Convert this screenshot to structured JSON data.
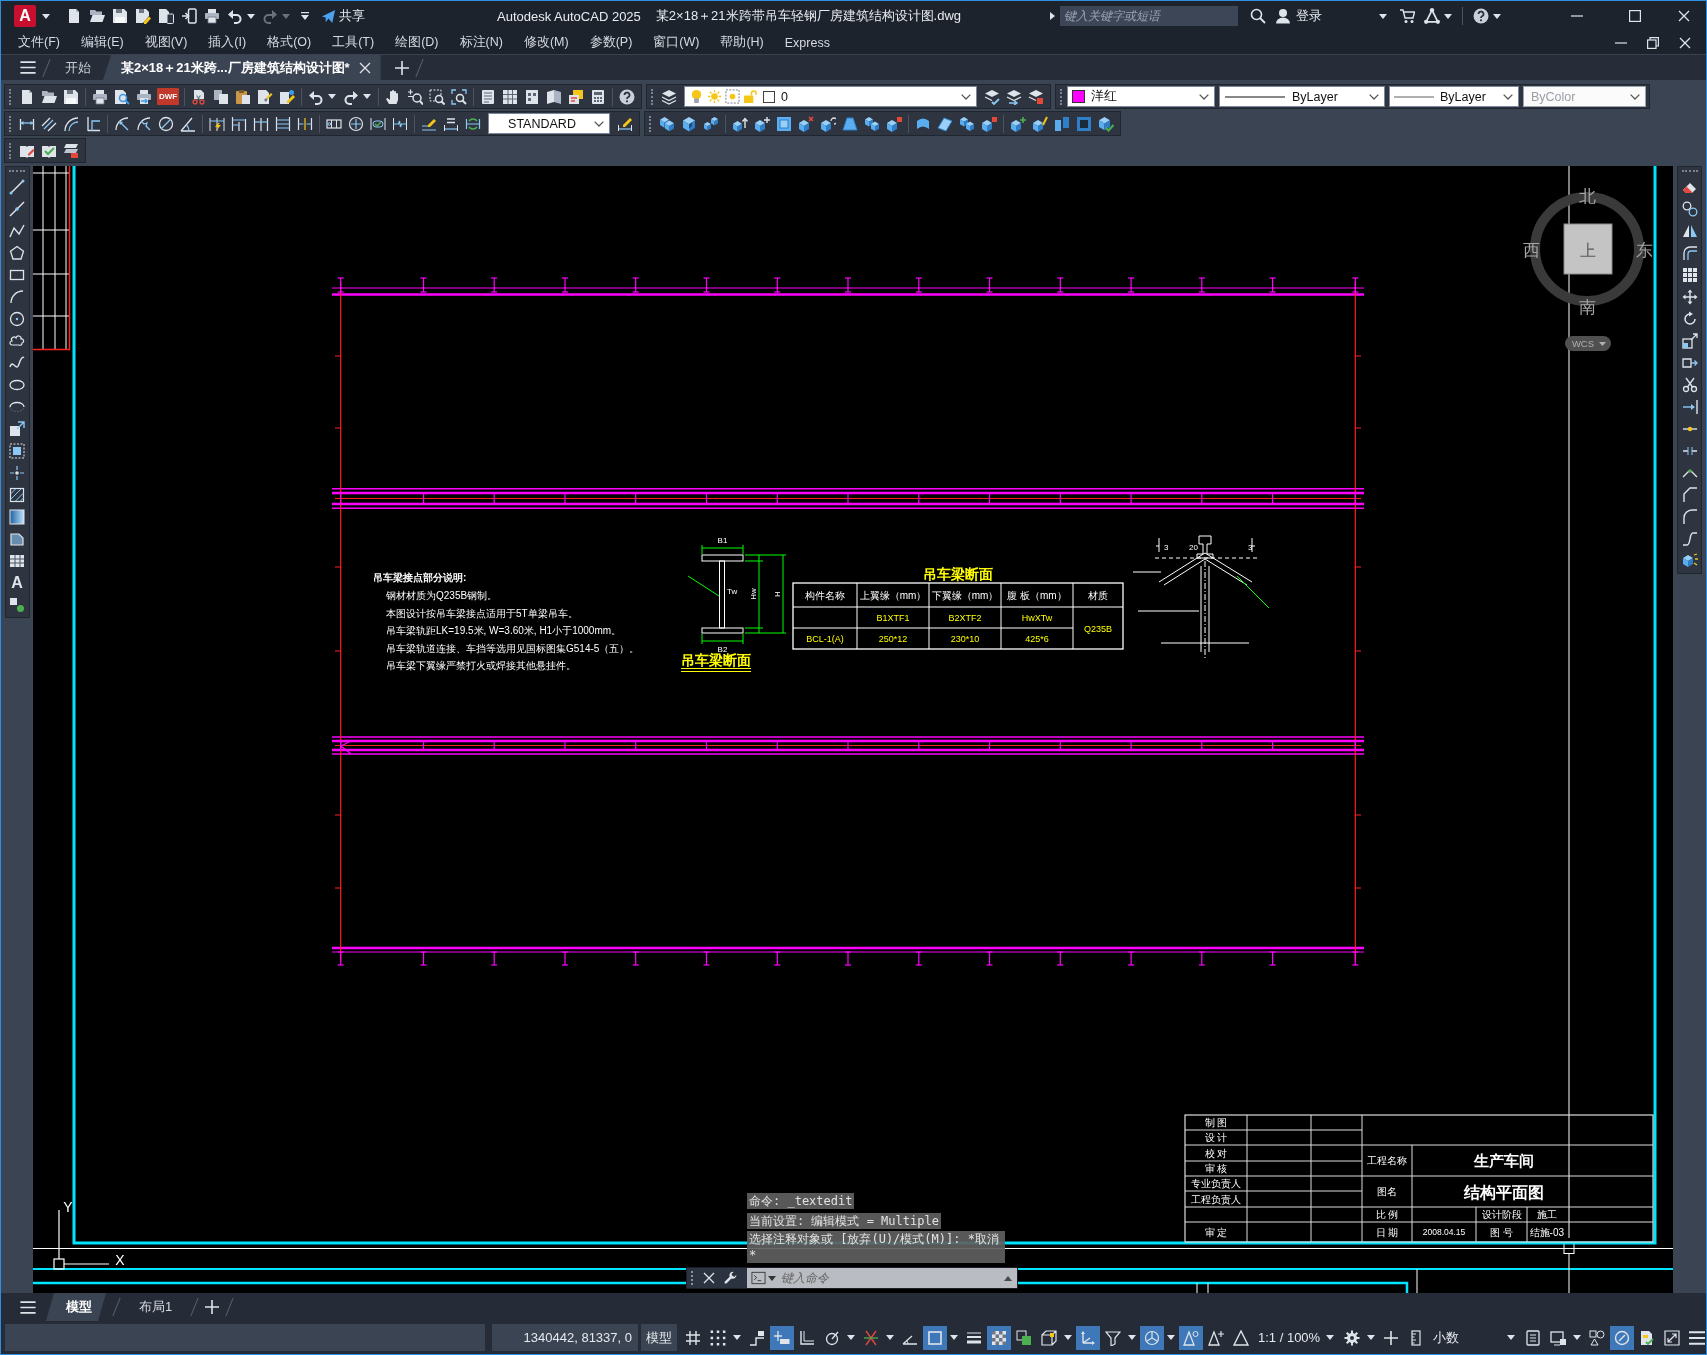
{
  "title_bar": {
    "app_logo": "A",
    "share": "共享",
    "redo_disabled": true,
    "app_name": "Autodesk AutoCAD 2025",
    "document": "某2×18＋21米跨带吊车轻钢厂房建筑结构设计图.dwg",
    "search": {
      "placeholder": "键入关键字或短语"
    },
    "sign_in": "登录"
  },
  "menu_bar": [
    "文件(F)",
    "编辑(E)",
    "视图(V)",
    "插入(I)",
    "格式(O)",
    "工具(T)",
    "绘图(D)",
    "标注(N)",
    "修改(M)",
    "参数(P)",
    "窗口(W)",
    "帮助(H)",
    "Express"
  ],
  "file_tabs": [
    {
      "label": "开始",
      "selected": false
    },
    {
      "label": "某2×18＋21米跨...厂房建筑结构设计图*",
      "selected": true
    }
  ],
  "toolbar": {
    "dwf_label": "DWF",
    "layer": "0",
    "color": {
      "label": "洋红",
      "color": "#ff00ff"
    },
    "linetype": "ByLayer",
    "lineweight": "ByLayer",
    "plot_style": {
      "label": "ByColor",
      "disabled": true
    },
    "text_style": "STANDARD"
  },
  "draw_toolbar": {
    "text_tool": "A"
  },
  "drawing": {
    "notes": {
      "title": "吊车梁接点部分说明:",
      "lines": [
        "钢材材质为Q235B钢制。",
        "本图设计按吊车梁接点适用于5T单梁吊车。",
        "吊车梁轨距LK=19.5米, W=3.60米, H1小于1000mm。",
        "吊车梁轨道连接、车挡等选用见国标图集G514-5（五）。",
        "吊车梁下翼缘严禁打火或焊接其他悬挂件。"
      ]
    },
    "beam_section": {
      "flange_top": "B1",
      "web": "Tw",
      "web_height": "Hw",
      "height": "H",
      "flange_bottom": "B2",
      "title": "吊车梁断面"
    },
    "section_table": {
      "title": "吊车梁断面",
      "columns": [
        "构件名称",
        "上翼缘（mm）",
        "下翼缘（mm）",
        "腹 板（mm）",
        "材质"
      ],
      "rows": [
        {
          "cells": [
            "",
            "B1XTF1",
            "B2XTF2",
            "HwXTw",
            "Q235B"
          ]
        },
        {
          "cells": [
            "BCL-1(A)",
            "250*12",
            "230*10",
            "425*6"
          ]
        }
      ]
    },
    "rail_detail": {
      "labels": [
        "3",
        "20",
        "3"
      ]
    },
    "view_cube": {
      "north": "北",
      "west": "西",
      "face": "上",
      "east": "东",
      "south": "南",
      "ucs_menu": "WCS"
    },
    "title_block": {
      "signatures": [
        "制 图",
        "设 计",
        "校 对",
        "审 核",
        "专业负责人",
        "工程负责人"
      ],
      "approval": "审 定",
      "project_label": "工程名称",
      "project": "生产车间",
      "drawing_label": "图名",
      "drawing": "结构平面图",
      "scale_label": "比 例",
      "stage_label": "设计阶段",
      "stage": "施工",
      "date_label": "日 期",
      "date": "2008.04.15",
      "number_label": "图 号",
      "number": "结施-03"
    },
    "ucs_icon": {
      "y": "Y",
      "x": "X"
    }
  },
  "command_line": {
    "history": [
      "命令: _textedit",
      "当前设置: 编辑模式 = Multiple",
      "选择注释对象或 [放弃(U)/模式(M)]: *取消*"
    ],
    "placeholder": "键入命令"
  },
  "layout_tabs": [
    {
      "label": "模型",
      "selected": true
    },
    {
      "label": "布局1",
      "selected": false
    }
  ],
  "status_bar": {
    "coordinates": "1340442, 81337, 0",
    "space": "模型",
    "toggles": [
      {
        "kind": "grid",
        "on": false,
        "menu": false
      },
      {
        "kind": "snap",
        "on": false,
        "menu": true
      },
      {
        "kind": "infer",
        "on": false,
        "menu": false
      },
      {
        "kind": "dynamic",
        "on": true,
        "menu": false
      },
      {
        "kind": "ortho",
        "on": false,
        "menu": false
      },
      {
        "kind": "polar",
        "on": false,
        "menu": true
      },
      {
        "kind": "tracking",
        "on": false,
        "menu": true
      },
      {
        "kind": "isodraft",
        "on": false,
        "menu": false
      },
      {
        "kind": "osnap",
        "on": true,
        "menu": true
      },
      {
        "kind": "lineweight",
        "on": false,
        "menu": false
      },
      {
        "kind": "transparency",
        "on": true,
        "menu": false
      },
      {
        "kind": "cycling",
        "on": false,
        "menu": false
      },
      {
        "kind": "osnap3d",
        "on": false,
        "menu": true
      },
      {
        "kind": "ducs",
        "on": true,
        "menu": false
      },
      {
        "kind": "filter",
        "on": false,
        "menu": true
      },
      {
        "kind": "gizmo",
        "on": true,
        "menu": true
      },
      {
        "kind": "annovis",
        "on": true,
        "menu": false
      },
      {
        "kind": "autoscale",
        "on": false,
        "menu": false
      },
      {
        "kind": "annoscale",
        "on": false,
        "menu": false
      }
    ],
    "scale": "1:1 / 100%",
    "tools_left": [
      {
        "kind": "gear",
        "on": false,
        "menu": true
      },
      {
        "kind": "plus",
        "on": false,
        "menu": false
      },
      {
        "kind": "units",
        "on": false,
        "menu": false
      }
    ],
    "number_format": "小数",
    "tools_right": [
      {
        "kind": "properties",
        "on": false,
        "menu": false
      },
      {
        "kind": "lockui",
        "on": false,
        "menu": true
      },
      {
        "kind": "isolate",
        "on": false,
        "menu": false
      },
      {
        "kind": "hardware",
        "on": true,
        "menu": false
      },
      {
        "kind": "monitor",
        "on": false,
        "menu": false
      },
      {
        "kind": "fullscreen",
        "on": false,
        "menu": false
      },
      {
        "kind": "menu",
        "on": false,
        "menu": false
      }
    ]
  }
}
